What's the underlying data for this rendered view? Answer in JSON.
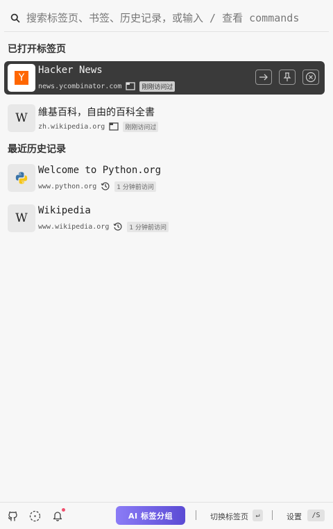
{
  "search": {
    "placeholder": "搜索标签页、书签、历史记录，或输入 / 查看 commands",
    "icon": "search-icon"
  },
  "sections": {
    "open_tabs": "已打开标签页",
    "history": "最近历史记录"
  },
  "open_tabs": [
    {
      "title": "Hacker News",
      "url": "news.ycombinator.com",
      "badge": "刚刚访问过",
      "icon": "hacker-news-favicon",
      "color": "#ff6600"
    },
    {
      "title": "維基百科，自由的百科全書",
      "url": "zh.wikipedia.org",
      "badge": "刚刚访问过",
      "icon": "wikipedia-favicon"
    }
  ],
  "history": [
    {
      "title": "Welcome to Python.org",
      "url": "www.python.org",
      "badge": "1 分钟前访问",
      "icon": "python-favicon"
    },
    {
      "title": "Wikipedia",
      "url": "www.wikipedia.org",
      "badge": "1 分钟前访问",
      "icon": "wikipedia-favicon"
    }
  ],
  "hn_logo_letter": "Y",
  "wiki_logo_letter": "W",
  "footer": {
    "ai_button": "AI 标签分组",
    "switch_label": "切换标签页",
    "switch_key": "↵",
    "settings_label": "设置",
    "settings_key": "/S",
    "accent": "#6b5ce7"
  }
}
